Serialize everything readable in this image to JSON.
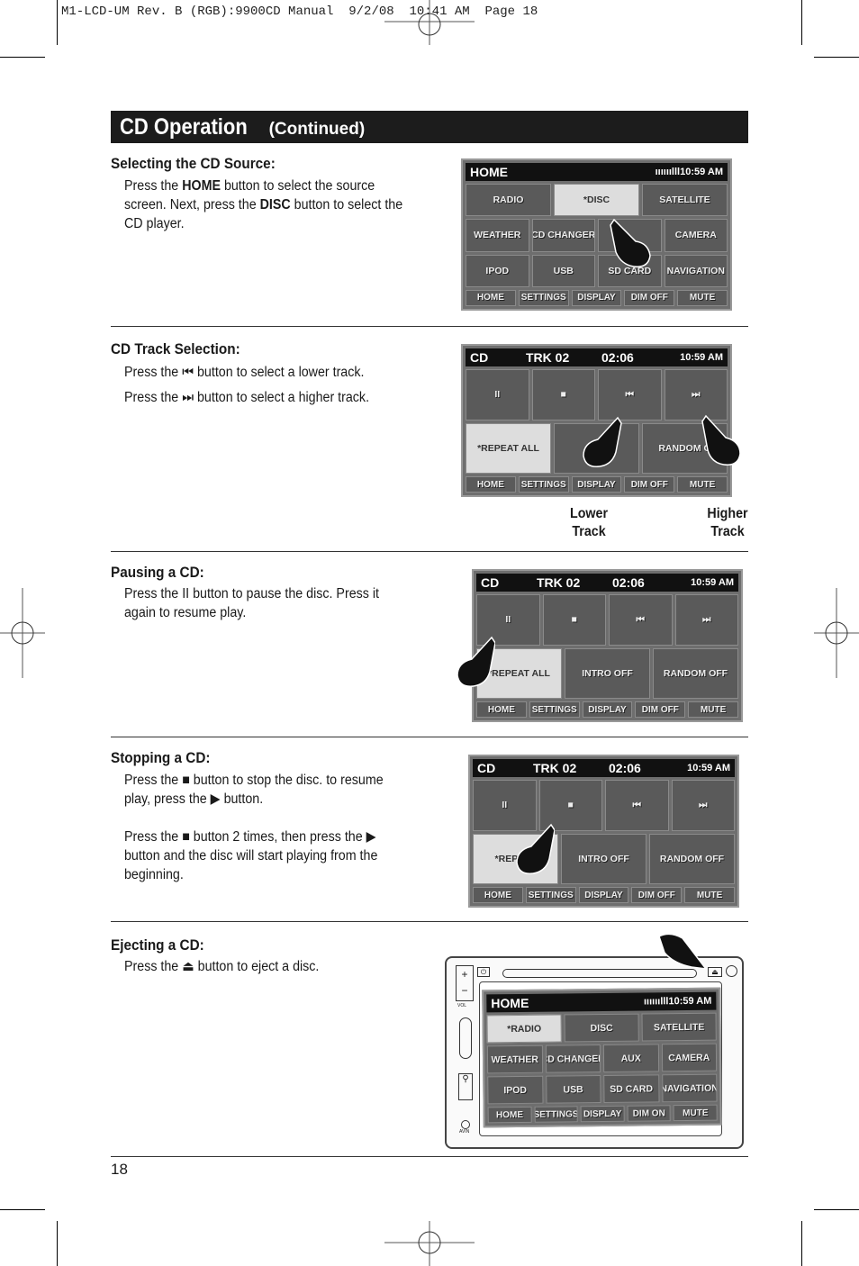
{
  "slug": "M1-LCD-UM Rev. B (RGB):9900CD Manual  9/2/08  10:41 AM  Page 18",
  "banner": {
    "title": "CD Operation",
    "continued": "(Continued)"
  },
  "sections": [
    {
      "heading": "Selecting the CD Source:",
      "paras": [
        [
          "Press the ",
          "HOME",
          " button to select the source screen. Next, press the ",
          "DISC",
          " button to select the CD player."
        ]
      ]
    },
    {
      "heading": "CD Track Selection:",
      "paras": [
        "Press the ⏮ button to select a lower track.",
        "Press the ⏭ button to select a higher track."
      ]
    },
    {
      "heading": "Pausing a CD:",
      "paras": [
        "Press the II button to pause the disc. Press it again to resume play."
      ]
    },
    {
      "heading": "Stopping a CD:",
      "paras": [
        "Press the ■ button to stop the disc. to resume play, press the ▶ button.",
        "Press the ■ button 2 times, then press the ▶ button and the disc will start playing from the beginning."
      ]
    },
    {
      "heading": "Ejecting a CD:",
      "paras": [
        "Press the ⏏ button to eject a disc."
      ]
    }
  ],
  "captions": {
    "lower": "Lower\nTrack",
    "higher": "Higher\nTrack"
  },
  "page_number": "18",
  "screens": [
    {
      "title": "HOME",
      "trk": "",
      "elapsed": "",
      "time": "10:59 AM",
      "signal": true,
      "rows": [
        [
          "RADIO",
          "*DISC",
          "SATELLITE"
        ],
        [
          "WEATHER",
          "CD CHANGER",
          "",
          "CAMERA"
        ],
        [
          "IPOD",
          "USB",
          "SD CARD",
          "NAVIGATION"
        ]
      ],
      "bottom": [
        "HOME",
        "SETTINGS",
        "DISPLAY",
        "DIM OFF",
        "MUTE"
      ]
    },
    {
      "title": "CD",
      "trk": "TRK 02",
      "elapsed": "02:06",
      "time": "10:59 AM",
      "rows": [
        [
          "II",
          "■",
          "⏮",
          "⏭"
        ],
        [
          "*REPEAT ALL",
          "INT",
          "RANDOM O"
        ]
      ],
      "bottom": [
        "HOME",
        "SETTINGS",
        "DISPLAY",
        "DIM OFF",
        "MUTE"
      ]
    },
    {
      "title": "CD",
      "trk": "TRK 02",
      "elapsed": "02:06",
      "time": "10:59 AM",
      "rows": [
        [
          "II",
          "■",
          "⏮",
          "⏭"
        ],
        [
          "*REPEAT ALL",
          "INTRO OFF",
          "RANDOM OFF"
        ]
      ],
      "bottom": [
        "HOME",
        "SETTINGS",
        "DISPLAY",
        "DIM OFF",
        "MUTE"
      ]
    },
    {
      "title": "CD",
      "trk": "TRK 02",
      "elapsed": "02:06",
      "time": "10:59 AM",
      "rows": [
        [
          "II",
          "■",
          "⏮",
          "⏭"
        ],
        [
          "*REPEAT",
          "INTRO OFF",
          "RANDOM OFF"
        ]
      ],
      "bottom": [
        "HOME",
        "SETTINGS",
        "DISPLAY",
        "DIM OFF",
        "MUTE"
      ]
    },
    {
      "title": "HOME",
      "trk": "",
      "elapsed": "",
      "time": "10:59 AM",
      "signal": true,
      "rows": [
        [
          "*RADIO",
          "DISC",
          "SATELLITE"
        ],
        [
          "WEATHER",
          "CD CHANGER",
          "AUX",
          "CAMERA"
        ],
        [
          "IPOD",
          "USB",
          "SD CARD",
          "NAVIGATION"
        ]
      ],
      "bottom": [
        "HOME",
        "SETTINGS",
        "DISPLAY",
        "DIM ON",
        "MUTE"
      ]
    }
  ],
  "device": {
    "vol_plus": "+",
    "vol_minus": "−",
    "vol_label": "VOL",
    "avin_label": "AVIN"
  }
}
